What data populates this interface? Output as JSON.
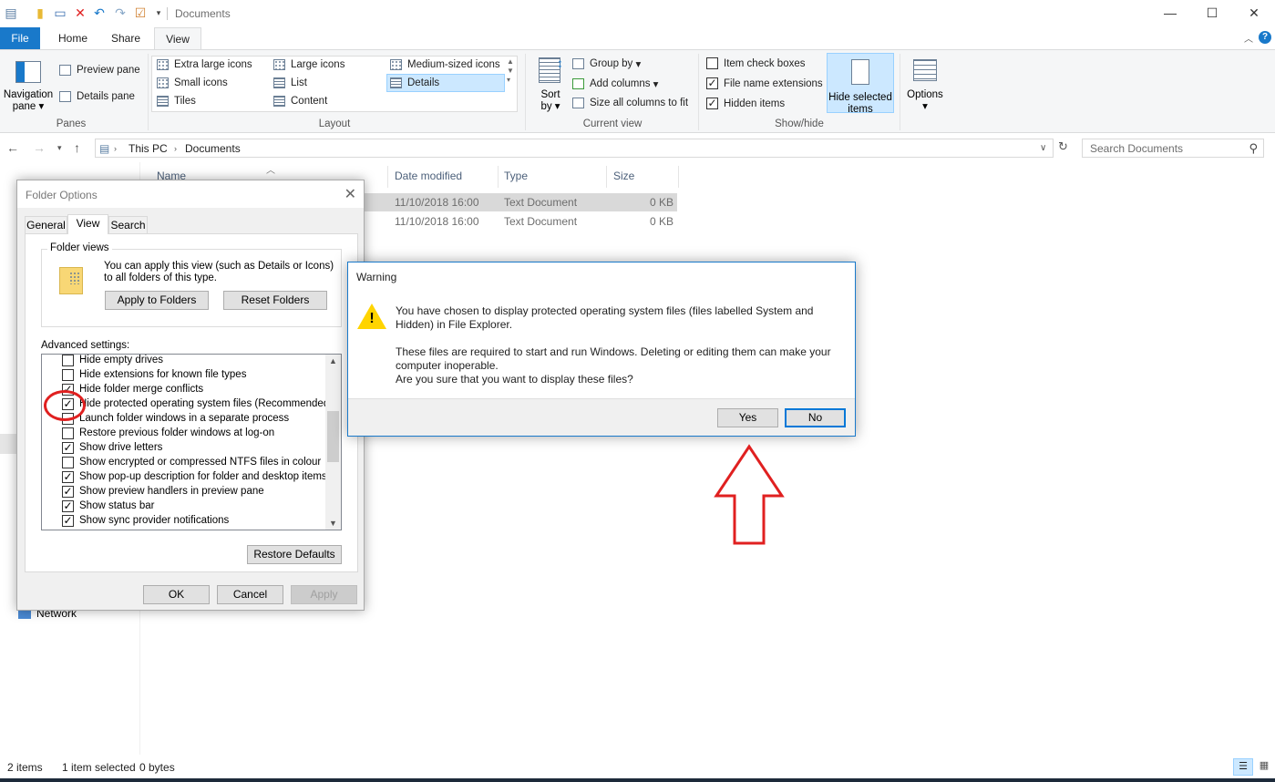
{
  "window": {
    "title": "Documents",
    "minimize": "—",
    "maximize": "☐",
    "close": "✕"
  },
  "tabs": {
    "file": "File",
    "home": "Home",
    "share": "Share",
    "view": "View"
  },
  "ribbon": {
    "panes": {
      "label": "Panes",
      "navigation_pane": "Navigation pane",
      "preview_pane": "Preview pane",
      "details_pane": "Details pane"
    },
    "layout": {
      "label": "Layout",
      "items": [
        "Extra large icons",
        "Large icons",
        "Medium-sized icons",
        "Small icons",
        "List",
        "Details",
        "Tiles",
        "Content"
      ],
      "selected": "Details"
    },
    "current_view": {
      "label": "Current view",
      "sort_by": "Sort by",
      "group_by": "Group by",
      "add_columns": "Add columns",
      "size_all_columns": "Size all columns to fit"
    },
    "show_hide": {
      "label": "Show/hide",
      "item_check_boxes": "Item check boxes",
      "item_check_boxes_checked": false,
      "file_name_extensions": "File name extensions",
      "file_name_extensions_checked": true,
      "hidden_items": "Hidden items",
      "hidden_items_checked": true,
      "hide_selected_items": "Hide selected items"
    },
    "options": "Options"
  },
  "address": {
    "crumbs": [
      "This PC",
      "Documents"
    ],
    "search_placeholder": "Search Documents"
  },
  "nav": {
    "network": "Network"
  },
  "file_list": {
    "columns": [
      "Name",
      "Date modified",
      "Type",
      "Size"
    ],
    "rows": [
      {
        "date": "11/10/2018 16:00",
        "type": "Text Document",
        "size": "0 KB"
      },
      {
        "date": "11/10/2018 16:00",
        "type": "Text Document",
        "size": "0 KB"
      }
    ]
  },
  "status": {
    "items": "2 items",
    "selected": "1 item selected",
    "size": "0 bytes"
  },
  "folder_options": {
    "title": "Folder Options",
    "tabs": [
      "General",
      "View",
      "Search"
    ],
    "folder_views_legend": "Folder views",
    "folder_views_desc": "You can apply this view (such as Details or Icons) to all folders of this type.",
    "apply_to_folders": "Apply to Folders",
    "reset_folders": "Reset Folders",
    "advanced_label": "Advanced settings:",
    "advanced_items": [
      {
        "label": "Hide empty drives",
        "checked": false
      },
      {
        "label": "Hide extensions for known file types",
        "checked": false
      },
      {
        "label": "Hide folder merge conflicts",
        "checked": true
      },
      {
        "label": "Hide protected operating system files (Recommended)",
        "checked": true
      },
      {
        "label": "Launch folder windows in a separate process",
        "checked": false
      },
      {
        "label": "Restore previous folder windows at log-on",
        "checked": false
      },
      {
        "label": "Show drive letters",
        "checked": true
      },
      {
        "label": "Show encrypted or compressed NTFS files in colour",
        "checked": false
      },
      {
        "label": "Show pop-up description for folder and desktop items",
        "checked": true
      },
      {
        "label": "Show preview handlers in preview pane",
        "checked": true
      },
      {
        "label": "Show status bar",
        "checked": true
      },
      {
        "label": "Show sync provider notifications",
        "checked": true
      }
    ],
    "restore_defaults": "Restore Defaults",
    "ok": "OK",
    "cancel": "Cancel",
    "apply": "Apply"
  },
  "warning": {
    "title": "Warning",
    "line1": "You have chosen to display protected operating system files (files labelled System and Hidden) in File Explorer.",
    "line2": "These files are required to start and run Windows. Deleting or editing them can make your computer inoperable.",
    "line3": "Are you sure that you want to display these files?",
    "yes": "Yes",
    "no": "No"
  },
  "colors": {
    "accent": "#1979ca",
    "selection": "#cce8ff",
    "annotation": "#e02020"
  }
}
